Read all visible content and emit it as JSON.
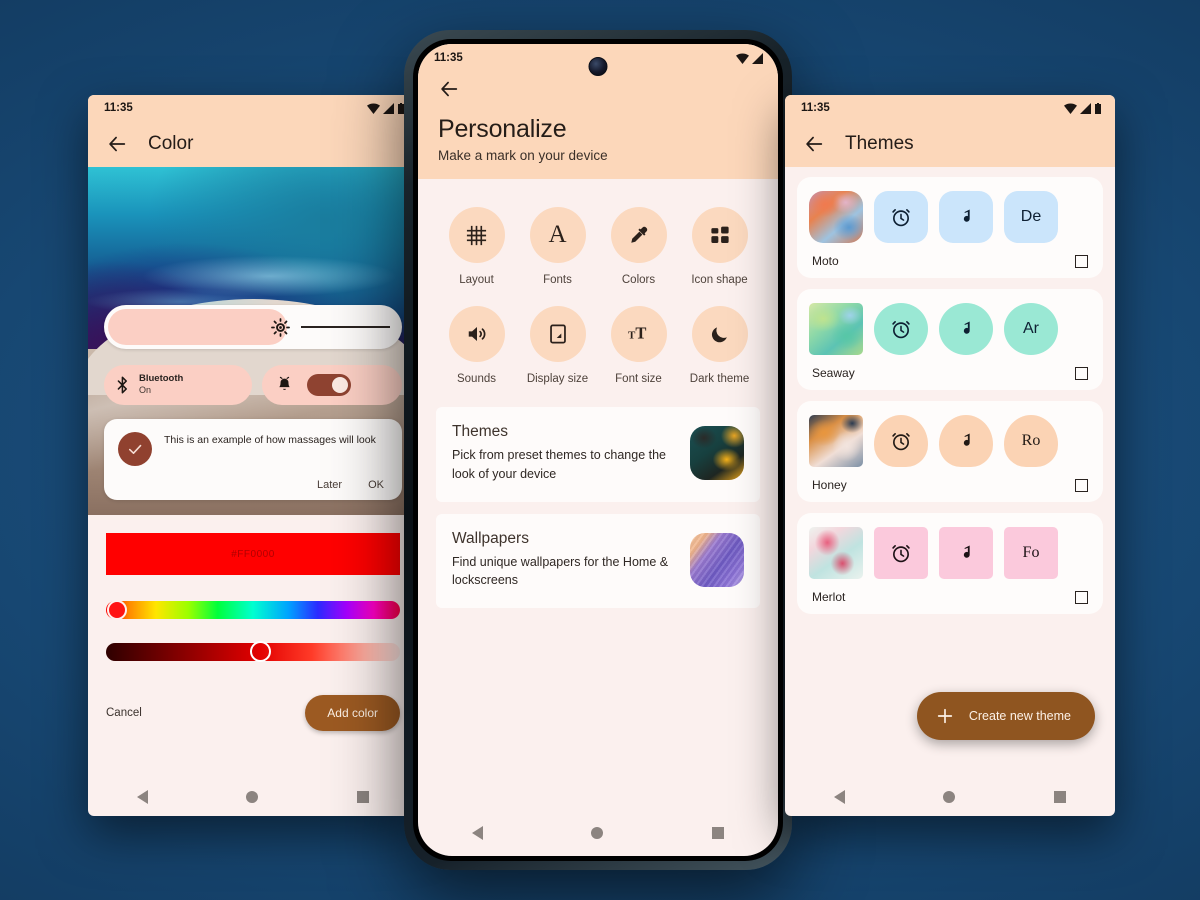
{
  "background_color": "#143a61",
  "left_phone": {
    "status_time": "11:35",
    "status_icons": [
      "wifi-icon",
      "signal-icon",
      "battery-icon"
    ],
    "appbar": {
      "back_icon": "back-arrow-icon",
      "title": "Color"
    },
    "preview": {
      "brightness": {
        "icon": "brightness-sun-icon",
        "fill_percent": 60
      },
      "bluetooth_tile": {
        "icon": "bluetooth-icon",
        "label": "Bluetooth",
        "state": "On"
      },
      "alarm_tile": {
        "icon": "alarm-bell-icon",
        "toggle_on": true
      },
      "message_card": {
        "check_icon": "check-circle-icon",
        "text": "This is an example of how massages will look",
        "action_secondary": "Later",
        "action_primary": "OK"
      }
    },
    "picker": {
      "swatch_color": "#FF0000",
      "swatch_label": "#FF0000",
      "hue_handle_percent": 1,
      "lightness_handle_percent": 49
    },
    "actions": {
      "cancel": "Cancel",
      "add": "Add color"
    },
    "navbar": [
      "nav-back-icon",
      "nav-home-icon",
      "nav-recents-icon"
    ]
  },
  "center_phone": {
    "status_time": "11:35",
    "status_icons": [
      "wifi-icon",
      "signal-icon"
    ],
    "camera_icon": "front-camera-icon",
    "header": {
      "back_icon": "back-arrow-icon",
      "title": "Personalize",
      "subtitle": "Make a mark on your device"
    },
    "grid": [
      {
        "icon": "layout-grid-icon",
        "label": "Layout"
      },
      {
        "icon": "fonts-letter-a-icon",
        "label": "Fonts"
      },
      {
        "icon": "colors-eyedropper-icon",
        "label": "Colors"
      },
      {
        "icon": "icon-shape-squares-icon",
        "label": "Icon shape"
      },
      {
        "icon": "sounds-speaker-icon",
        "label": "Sounds"
      },
      {
        "icon": "display-size-icon",
        "label": "Display size"
      },
      {
        "icon": "font-size-tt-icon",
        "label": "Font size"
      },
      {
        "icon": "dark-theme-moon-icon",
        "label": "Dark theme"
      }
    ],
    "cards": [
      {
        "title": "Themes",
        "desc": "Pick from preset themes to change the look of your device",
        "thumb": "themes-thumbnail"
      },
      {
        "title": "Wallpapers",
        "desc": "Find unique wallpapers for the Home & lockscreens",
        "thumb": "wallpapers-thumbnail"
      }
    ],
    "navbar": [
      "nav-back-icon",
      "nav-home-icon",
      "nav-recents-icon"
    ]
  },
  "right_phone": {
    "status_time": "11:35",
    "status_icons": [
      "wifi-icon",
      "signal-icon",
      "battery-icon"
    ],
    "appbar": {
      "back_icon": "back-arrow-icon",
      "title": "Themes"
    },
    "themes": [
      {
        "name": "Moto",
        "shape": "shape-moto",
        "tile_color": "#cbe5fb",
        "initials": "De",
        "selected": false
      },
      {
        "name": "Seaway",
        "shape": "shape-seaway",
        "tile_color": "#9ae8d4",
        "initials": "Ar",
        "selected": false
      },
      {
        "name": "Honey",
        "shape": "shape-honey",
        "tile_color": "#fbd3b4",
        "initials": "Ro",
        "selected": false
      },
      {
        "name": "Merlot",
        "shape": "shape-merlot",
        "tile_color": "#fbc9dc",
        "initials": "Fo",
        "selected": false
      }
    ],
    "fab": {
      "icon": "plus-icon",
      "label": "Create new theme"
    },
    "navbar": [
      "nav-back-icon",
      "nav-home-icon",
      "nav-recents-icon"
    ]
  }
}
